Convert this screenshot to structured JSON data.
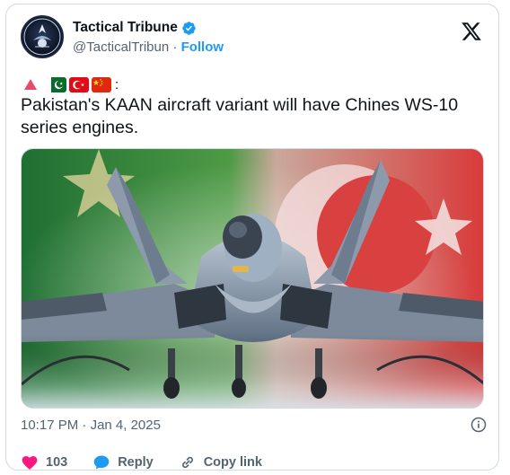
{
  "account": {
    "display_name": "Tactical Tribune",
    "handle": "@TacticalTribun",
    "separator": "·",
    "follow_label": "Follow"
  },
  "tweet": {
    "colon": ":",
    "text": "Pakistan's KAAN aircraft variant will have Chines WS-10 series engines."
  },
  "meta": {
    "time": "10:17 PM",
    "separator": "·",
    "date": "Jan 4, 2025"
  },
  "actions": {
    "like_count": "103",
    "reply_label": "Reply",
    "copy_link_label": "Copy link"
  },
  "colors": {
    "accent": "#1d9bf0",
    "like": "#f91880",
    "muted": "#536471"
  },
  "icons": [
    "x-logo-icon",
    "verified-icon",
    "info-icon",
    "heart-icon",
    "reply-bubble-icon",
    "link-icon"
  ]
}
